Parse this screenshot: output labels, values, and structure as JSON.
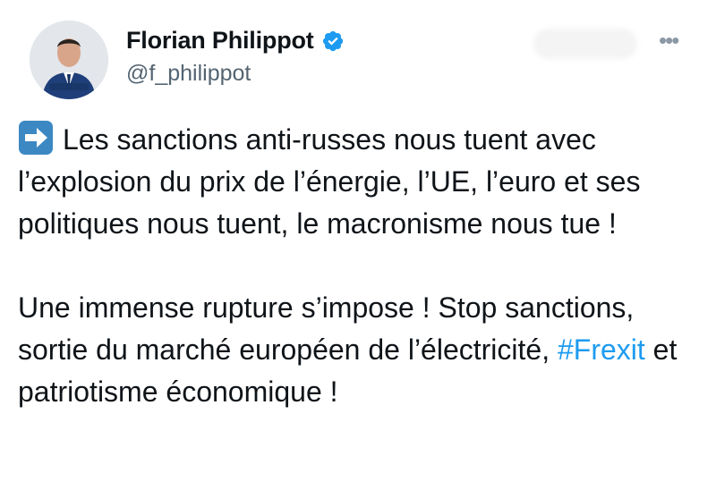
{
  "author": {
    "name": "Florian Philippot",
    "handle": "@f_philippot",
    "avatar": "avatar",
    "verified_icon": "verified-badge-icon"
  },
  "more_icon": "more-icon",
  "tweet": {
    "p1_text": "Les sanctions anti-russes nous tuent avec l’explosion du prix de l’énergie, l’UE, l’euro et ses politiques nous tuent, le macronisme nous tue !",
    "p1_emoji": "right-arrow-emoji",
    "p2_before": "Une immense rupture s’impose ! Stop sanctions, sortie du marché européen de l’électricité, ",
    "hashtag": "#Frexit",
    "p2_after": " et patriotisme économique !"
  },
  "colors": {
    "accent": "#1d9bf0",
    "text": "#0f1419",
    "muted": "#536471"
  }
}
